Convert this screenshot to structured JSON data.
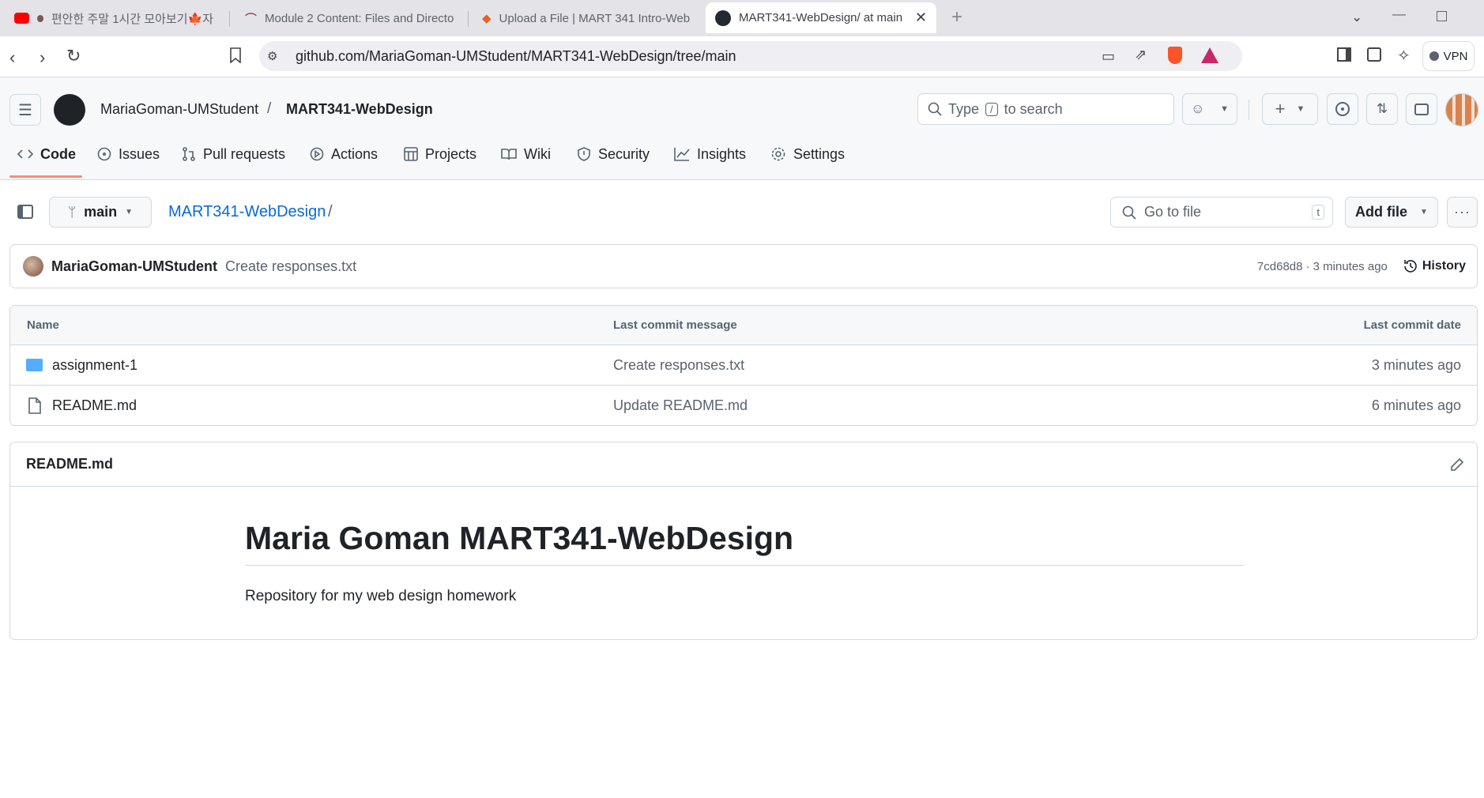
{
  "browser": {
    "tabs": [
      {
        "title": "편안한 주말 1시간 모아보기🍁자"
      },
      {
        "title": "Module 2 Content: Files and Directo"
      },
      {
        "title": "Upload a File | MART 341 Intro-Web"
      },
      {
        "title": "MART341-WebDesign/ at main"
      }
    ],
    "url": "github.com/MariaGoman-UMStudent/MART341-WebDesign/tree/main",
    "vpn_label": "VPN"
  },
  "header": {
    "owner": "MariaGoman-UMStudent",
    "separator": "/",
    "repo": "MART341-WebDesign",
    "search_prefix": "Type",
    "search_key": "/",
    "search_suffix": "to search"
  },
  "nav": {
    "tabs": [
      "Code",
      "Issues",
      "Pull requests",
      "Actions",
      "Projects",
      "Wiki",
      "Security",
      "Insights",
      "Settings"
    ]
  },
  "toolbar": {
    "branch": "main",
    "breadcrumb_repo": "MART341-WebDesign",
    "breadcrumb_sep": "/",
    "goto_placeholder": "Go to file",
    "goto_key": "t",
    "add_file": "Add file"
  },
  "commit": {
    "author": "MariaGoman-UMStudent",
    "message": "Create responses.txt",
    "sha": "7cd68d8",
    "time": "· 3 minutes ago",
    "history": "History"
  },
  "files": {
    "headers": [
      "Name",
      "Last commit message",
      "Last commit date"
    ],
    "rows": [
      {
        "name": "assignment-1",
        "type": "folder",
        "message": "Create responses.txt",
        "date": "3 minutes ago"
      },
      {
        "name": "README.md",
        "type": "file",
        "message": "Update README.md",
        "date": "6 minutes ago"
      }
    ]
  },
  "readme": {
    "filename": "README.md",
    "title": "Maria Goman MART341-WebDesign",
    "body": "Repository for my web design homework"
  }
}
